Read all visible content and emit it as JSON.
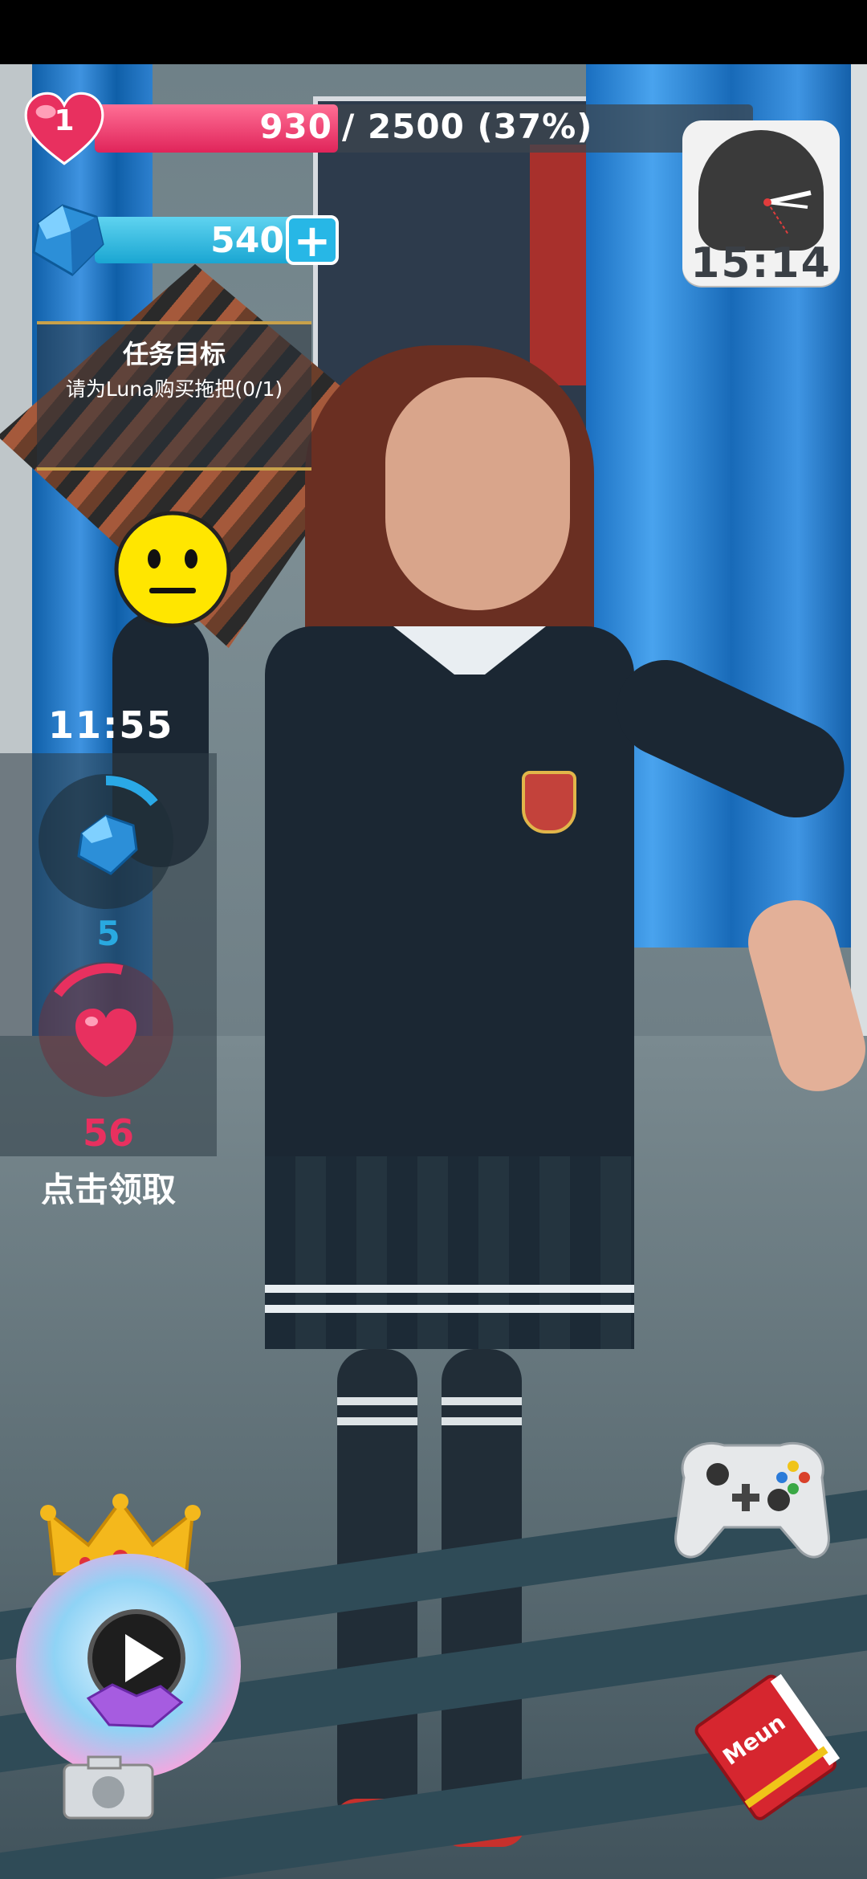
{
  "player": {
    "level": "1",
    "xp_current": "930",
    "xp_progress_text": "/ 2500 (37%)",
    "xp_fraction": 0.372,
    "gems": "540",
    "add_gems_label": "+"
  },
  "clock": {
    "time": "15:14"
  },
  "task": {
    "title": "任务目标",
    "description": "请为Luna购买拖把(0/1)"
  },
  "mood": {
    "icon": "neutral-face-icon"
  },
  "rewards": {
    "timer": "11:55",
    "gem_amount": "5",
    "heart_amount": "56",
    "claim_label": "点击领取"
  },
  "buttons": {
    "gamepad": "gamepad-icon",
    "vip": "vip-crown-play-icon",
    "menu_book_label": "Meun"
  },
  "colors": {
    "heart": "#e8305f",
    "gem": "#29a9e0",
    "xp_fill": "#e0245a",
    "task_border": "#c8a14a"
  }
}
